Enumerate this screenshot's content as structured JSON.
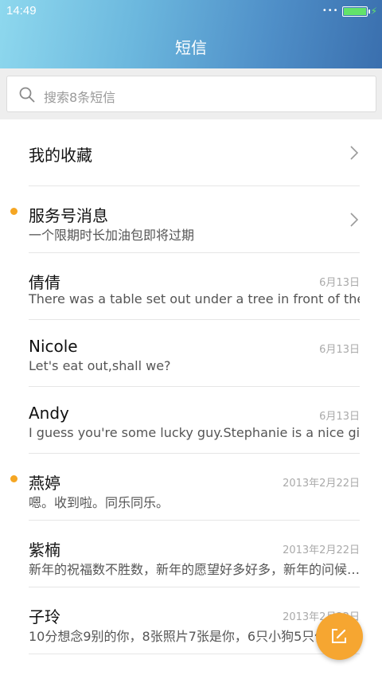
{
  "status": {
    "time": "14:49"
  },
  "header": {
    "title": "短信"
  },
  "search": {
    "placeholder": "搜索8条短信"
  },
  "favorites": {
    "label": "我的收藏"
  },
  "service": {
    "name": "服务号消息",
    "preview": "一个限期时长加油包即将过期",
    "unread": true
  },
  "conversations": [
    {
      "name": "倩倩",
      "date": "6月13日",
      "preview": "There was a table set out under a tree in front of the ho…",
      "unread": false
    },
    {
      "name": "Nicole",
      "date": "6月13日",
      "preview": "Let's eat out,shall we?",
      "unread": false
    },
    {
      "name": "Andy",
      "date": "6月13日",
      "preview": "I guess you're some lucky guy.Stephanie is a nice girl.",
      "unread": false
    },
    {
      "name": "燕婷",
      "date": "2013年2月22日",
      "preview": "嗯。收到啦。同乐同乐。",
      "unread": true
    },
    {
      "name": "紫楠",
      "date": "2013年2月22日",
      "preview": "新年的祝福数不胜数，新年的愿望好多好多，新年的问候…",
      "unread": false
    },
    {
      "name": "子玲",
      "date": "2013年2月22日",
      "preview": "10分想念9别的你，8张照片7张是你，6只小狗5只像你",
      "unread": false
    }
  ],
  "colors": {
    "accent": "#f6a631",
    "unread_dot": "#f5a623",
    "header_start": "#8ed8ee",
    "header_end": "#3a6fae"
  },
  "icons": {
    "search": "search-icon",
    "chevron": "chevron-right-icon",
    "compose": "compose-icon"
  }
}
